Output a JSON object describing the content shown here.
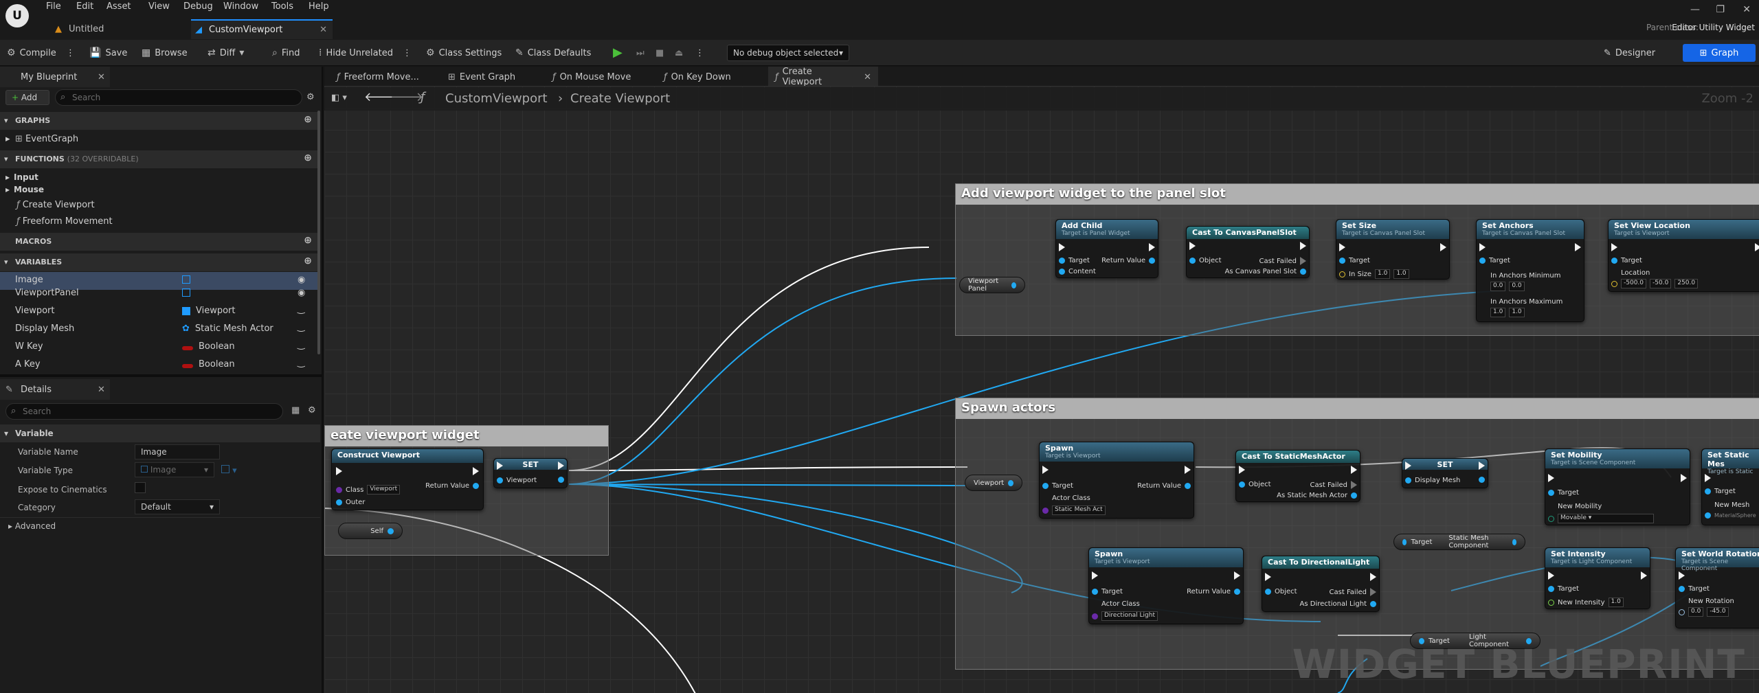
{
  "menu": [
    "File",
    "Edit",
    "Asset",
    "View",
    "Debug",
    "Window",
    "Tools",
    "Help"
  ],
  "doc_tabs": [
    {
      "label": "Untitled"
    },
    {
      "label": "CustomViewport"
    }
  ],
  "parent_class": {
    "label": "Parent class:",
    "value": "Editor Utility Widget"
  },
  "toolbar": {
    "compile": "Compile",
    "save": "Save",
    "browse": "Browse",
    "diff": "Diff",
    "find": "Find",
    "hide_unrelated": "Hide Unrelated",
    "class_settings": "Class Settings",
    "class_defaults": "Class Defaults",
    "debug_object": "No debug object selected",
    "designer": "Designer",
    "graph": "Graph"
  },
  "my_blueprint": {
    "tab": "My Blueprint",
    "add": "Add",
    "search_placeholder": "Search",
    "graphs_header": "GRAPHS",
    "event_graph": "EventGraph",
    "functions_header": "FUNCTIONS",
    "functions_hint": "(32 OVERRIDABLE)",
    "functions": [
      "Input",
      "Mouse",
      "Create Viewport",
      "Freeform Movement"
    ],
    "macros_header": "MACROS",
    "variables_header": "VARIABLES",
    "variables": [
      {
        "name": "Image",
        "type": "",
        "color": "#1f9bff"
      },
      {
        "name": "ViewportPanel",
        "type": "",
        "color": "#1f9bff"
      },
      {
        "name": "Viewport",
        "type": "Viewport",
        "color": "#1f9bff"
      },
      {
        "name": "Display Mesh",
        "type": "Static Mesh Actor",
        "color": "#1f9bff"
      },
      {
        "name": "W Key",
        "type": "Boolean",
        "color": "#b01010"
      },
      {
        "name": "A Key",
        "type": "Boolean",
        "color": "#b01010"
      }
    ]
  },
  "details": {
    "tab": "Details",
    "search_placeholder": "Search",
    "section": "Variable",
    "variable_name_label": "Variable Name",
    "variable_name": "Image",
    "variable_type_label": "Variable Type",
    "variable_type": "Image",
    "expose_label": "Expose to Cinematics",
    "category_label": "Category",
    "category": "Default",
    "advanced": "Advanced"
  },
  "graph_tabs": [
    "Freeform Move...",
    "Event Graph",
    "On Mouse Move",
    "On Key Down",
    "Create Viewport"
  ],
  "breadcrumb": {
    "root": "CustomViewport",
    "current": "Create Viewport"
  },
  "zoom": "Zoom -2",
  "comments": {
    "panel_slot": "Add viewport widget to the panel slot",
    "spawn": "Spawn actors",
    "create": "eate viewport widget"
  },
  "nodes": {
    "construct": {
      "title": "Construct Viewport",
      "class_label": "Class",
      "class_value": "Viewport",
      "return": "Return Value",
      "outer": "Outer"
    },
    "set1": {
      "title": "SET",
      "pin": "Viewport"
    },
    "self": "Self",
    "add_child": {
      "title": "Add Child",
      "sub": "Target is Panel Widget",
      "target": "Target",
      "content": "Content",
      "return": "Return Value"
    },
    "cast_canvas": {
      "title": "Cast To CanvasPanelSlot",
      "object": "Object",
      "failed": "Cast Failed",
      "as": "As Canvas Panel Slot"
    },
    "set_size": {
      "title": "Set Size",
      "sub": "Target is Canvas Panel Slot",
      "target": "Target",
      "in_size": "In Size",
      "x": "1.0",
      "y": "1.0"
    },
    "set_anchors": {
      "title": "Set Anchors",
      "sub": "Target is Canvas Panel Slot",
      "target": "Target",
      "min": "In Anchors Minimum",
      "max": "In Anchors Maximum",
      "min_x": "0.0",
      "min_y": "0.0",
      "max_x": "1.0",
      "max_y": "1.0"
    },
    "set_view": {
      "title": "Set View Location",
      "sub": "Target is Viewport",
      "target": "Target",
      "location": "Location",
      "x": "-500.0",
      "y": "-50.0",
      "z": "250.0"
    },
    "viewport_panel": "Viewport Panel",
    "viewport_var": "Viewport",
    "spawn1": {
      "title": "Spawn",
      "sub": "Target is Viewport",
      "target": "Target",
      "actor_class": "Actor Class",
      "class_value": "Static Mesh Act",
      "return": "Return Value"
    },
    "cast_sma": {
      "title": "Cast To StaticMeshActor",
      "object": "Object",
      "failed": "Cast Failed",
      "as": "As Static Mesh Actor"
    },
    "set2": {
      "title": "SET",
      "pin": "Display Mesh"
    },
    "set_mobility": {
      "title": "Set Mobility",
      "sub": "Target is Scene Component",
      "target": "Target",
      "new": "New Mobility",
      "value": "Movable"
    },
    "set_static": {
      "title": "Set Static Mes",
      "sub": "Target is Static",
      "target": "Target",
      "new": "New Mesh",
      "value": "MaterialSphere"
    },
    "smc": {
      "target": "Target",
      "label": "Static Mesh Component"
    },
    "spawn2": {
      "title": "Spawn",
      "sub": "Target is Viewport",
      "target": "Target",
      "actor_class": "Actor Class",
      "class_value": "Directional Light",
      "return": "Return Value"
    },
    "cast_dl": {
      "title": "Cast To DirectionalLight",
      "object": "Object",
      "failed": "Cast Failed",
      "as": "As Directional Light"
    },
    "set_intensity": {
      "title": "Set Intensity",
      "sub": "Target is Light Component",
      "target": "Target",
      "new": "New Intensity",
      "value": "1.0"
    },
    "set_rotation": {
      "title": "Set World Rotation",
      "sub": "Target is Scene Component",
      "target": "Target",
      "new": "New Rotation",
      "x": "0.0",
      "y": "-45.0"
    },
    "lc": {
      "target": "Target",
      "label": "Light Component"
    }
  },
  "watermark": "WIDGET BLUEPRINT"
}
